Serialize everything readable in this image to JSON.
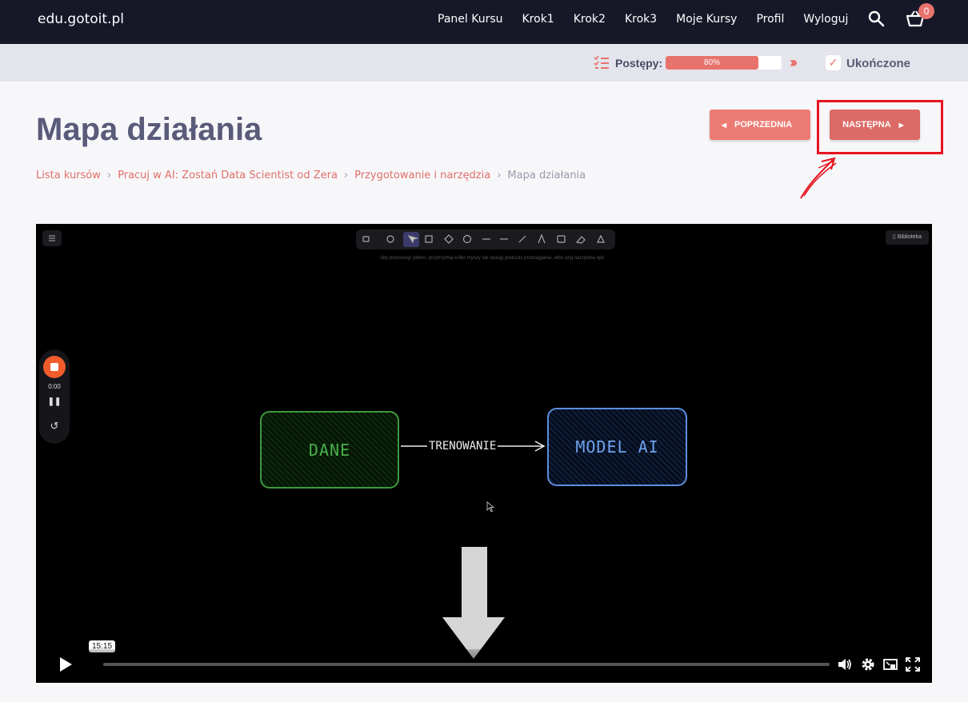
{
  "header": {
    "logo": "edu.gotoit.pl",
    "nav": [
      "Panel Kursu",
      "Krok1",
      "Krok2",
      "Krok3",
      "Moje Kursy",
      "Profil",
      "Wyloguj"
    ],
    "cart_count": "0"
  },
  "progress": {
    "label": "Postępy:",
    "value_text": "80%",
    "value": 0.8,
    "completed_label": "Ukończone",
    "completed_mark": "✓"
  },
  "page": {
    "title": "Mapa działania",
    "prev_label": "POPRZEDNIA",
    "next_label": "NASTĘPNA"
  },
  "breadcrumb": {
    "items": [
      "Lista kursów",
      "Pracuj w AI: Zostań Data Scientist od Zera",
      "Przygotowanie i narzędzia"
    ],
    "current": "Mapa działania"
  },
  "video": {
    "hint": "Aby przesunąć płótno, przytrzymaj kółko myszy lub spację podczas przeciągania, albo użyj narzędzia ręki",
    "library_label": "Biblioteka",
    "rec_time": "0:00",
    "diagram": {
      "left_box": "DANE",
      "arrow_label": "TRENOWANIE",
      "right_box": "MODEL AI"
    },
    "time_tooltip": "15:15"
  },
  "colors": {
    "accent": "#e8736d",
    "nav_bg": "#161828",
    "highlight": "#e5141e"
  }
}
